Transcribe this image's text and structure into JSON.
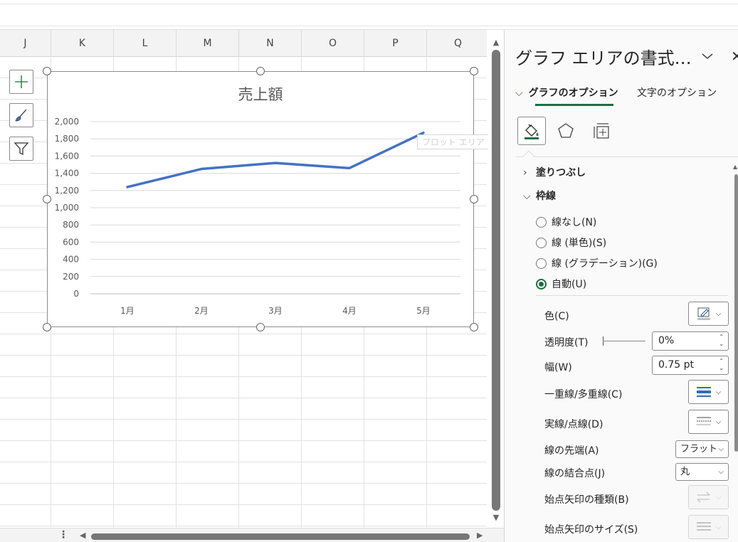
{
  "sheet": {
    "columns": [
      "J",
      "K",
      "L",
      "M",
      "N",
      "O",
      "P",
      "Q"
    ]
  },
  "chart_tools": {
    "add_icon": "plus-icon",
    "style_icon": "brush-icon",
    "filter_icon": "filter-icon"
  },
  "chart_data": {
    "type": "line",
    "title": "売上額",
    "categories": [
      "1月",
      "2月",
      "3月",
      "4月",
      "5月"
    ],
    "series": [
      {
        "values": [
          1240,
          1450,
          1520,
          1460,
          1870
        ],
        "color": "#4472c4"
      }
    ],
    "ylim": [
      0,
      2000
    ],
    "yticks": [
      "0",
      "200",
      "400",
      "600",
      "800",
      "1,000",
      "1,200",
      "1,400",
      "1,600",
      "1,800",
      "2,000"
    ],
    "grid": true,
    "legend": "none"
  },
  "tooltip": "プロット エリア",
  "panel": {
    "title": "グラフ エリアの書式…",
    "tabs": [
      "グラフのオプション",
      "文字のオプション"
    ],
    "icon_tabs": [
      "fill-line-icon",
      "effects-pentagon-icon",
      "size-properties-icon"
    ],
    "sections": {
      "fill": "塗りつぶし",
      "border": "枠線"
    },
    "border_options": [
      "線なし(N)",
      "線 (単色)(S)",
      "線 (グラデーション)(G)",
      "自動(U)"
    ],
    "selected_option": "自動(U)",
    "props": {
      "color_label": "色(C)",
      "transparency_label": "透明度(T)",
      "transparency_value": "0%",
      "width_label": "幅(W)",
      "width_value": "0.75 pt",
      "compound_label": "一重線/多重線(C)",
      "dash_label": "実線/点線(D)",
      "cap_label": "線の先端(A)",
      "cap_value": "フラット",
      "join_label": "線の結合点(J)",
      "join_value": "丸",
      "begin_arrow_type_label": "始点矢印の種類(B)",
      "begin_arrow_size_label": "始点矢印のサイズ(S)"
    }
  },
  "colors": {
    "accent_green": "#1e6e43",
    "series_blue": "#4472c4"
  }
}
